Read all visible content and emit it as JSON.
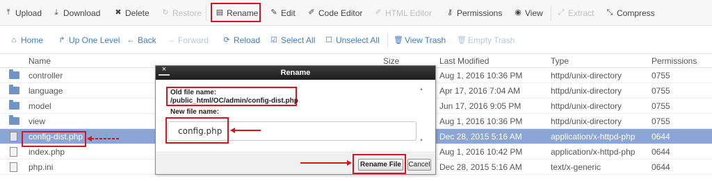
{
  "toolbar": {
    "upload": "Upload",
    "download": "Download",
    "delete": "Delete",
    "restore": "Restore",
    "rename": "Rename",
    "edit": "Edit",
    "code_editor": "Code Editor",
    "html_editor": "HTML Editor",
    "permissions": "Permissions",
    "view": "View",
    "extract": "Extract",
    "compress": "Compress"
  },
  "navbar": {
    "home": "Home",
    "up_one_level": "Up One Level",
    "back": "Back",
    "forward": "Forward",
    "reload": "Reload",
    "select_all": "Select All",
    "unselect_all": "Unselect All",
    "view_trash": "View Trash",
    "empty_trash": "Empty Trash"
  },
  "table": {
    "columns": {
      "name": "Name",
      "size": "Size",
      "last_modified": "Last Modified",
      "type": "Type",
      "permissions": "Permissions"
    },
    "rows": [
      {
        "name": "controller",
        "modified": "Aug 1, 2016 10:36 PM",
        "type": "httpd/unix-directory",
        "perm": "0755",
        "icon": "folder-icon"
      },
      {
        "name": "language",
        "modified": "Apr 17, 2016 7:04 AM",
        "type": "httpd/unix-directory",
        "perm": "0755",
        "icon": "folder-icon"
      },
      {
        "name": "model",
        "modified": "Jun 17, 2016 9:05 PM",
        "type": "httpd/unix-directory",
        "perm": "0755",
        "icon": "folder-icon"
      },
      {
        "name": "view",
        "modified": "Aug 1, 2016 10:36 PM",
        "type": "httpd/unix-directory",
        "perm": "0755",
        "icon": "folder-icon"
      },
      {
        "name": "config-dist.php",
        "modified": "Dec 28, 2015 5:16 AM",
        "type": "application/x-httpd-php",
        "perm": "0644",
        "icon": "php-file-icon"
      },
      {
        "name": "index.php",
        "modified": "Aug 1, 2016 10:42 PM",
        "type": "application/x-httpd-php",
        "perm": "0644",
        "icon": "php-file-icon"
      },
      {
        "name": "php.ini",
        "modified": "Dec 28, 2015 5:16 AM",
        "type": "text/x-generic",
        "perm": "0644",
        "icon": "file-icon"
      }
    ]
  },
  "dialog": {
    "title": "Rename",
    "close": "×",
    "old_label": "Old file name:",
    "old_path": "/public_html/OC/admin/config-dist.php",
    "new_label": "New file name:",
    "new_value": "config.php",
    "rename_button": "Rename File",
    "cancel_button": "Cancel"
  },
  "colors": {
    "highlight": "#d9121c",
    "selected_row": "#8ba5d8",
    "nav_link": "#3f7cc0"
  }
}
